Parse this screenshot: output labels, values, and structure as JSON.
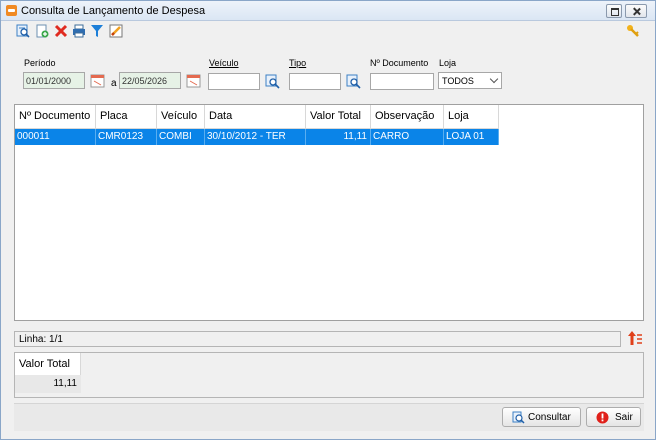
{
  "window": {
    "title": "Consulta de Lançamento de Despesa"
  },
  "toolbar": {
    "icons": [
      "search-preview-icon",
      "add-document-icon",
      "delete-x-icon",
      "print-icon",
      "filter-icon",
      "edit-pencil-icon"
    ],
    "right_icon": "key-icon"
  },
  "filters": {
    "periodo_label": "Período",
    "periodo_start": "01/01/2000",
    "periodo_sep": "a",
    "periodo_end": "22/05/2026",
    "veiculo_label": "Veículo",
    "veiculo_value": "",
    "tipo_label": "Tipo",
    "tipo_value": "",
    "documento_label": "Nº Documento",
    "documento_value": "",
    "loja_label": "Loja",
    "loja_value": "TODOS"
  },
  "grid": {
    "columns": [
      "Nº Documento",
      "Placa",
      "Veículo",
      "Data",
      "Valor Total",
      "Observação",
      "Loja"
    ],
    "rows": [
      [
        "000011",
        "CMR0123",
        "COMBI",
        "30/10/2012 - TER",
        "11,11",
        "CARRO",
        "LOJA 01"
      ]
    ]
  },
  "status": {
    "linha": "Linha: 1/1"
  },
  "totals": {
    "header": "Valor Total",
    "value": "11,11"
  },
  "buttons": {
    "consultar": "Consultar",
    "sair": "Sair"
  },
  "colors": {
    "selection": "#0a84e8",
    "date_field": "#e6f2e6",
    "accent_orange": "#f08a24"
  }
}
